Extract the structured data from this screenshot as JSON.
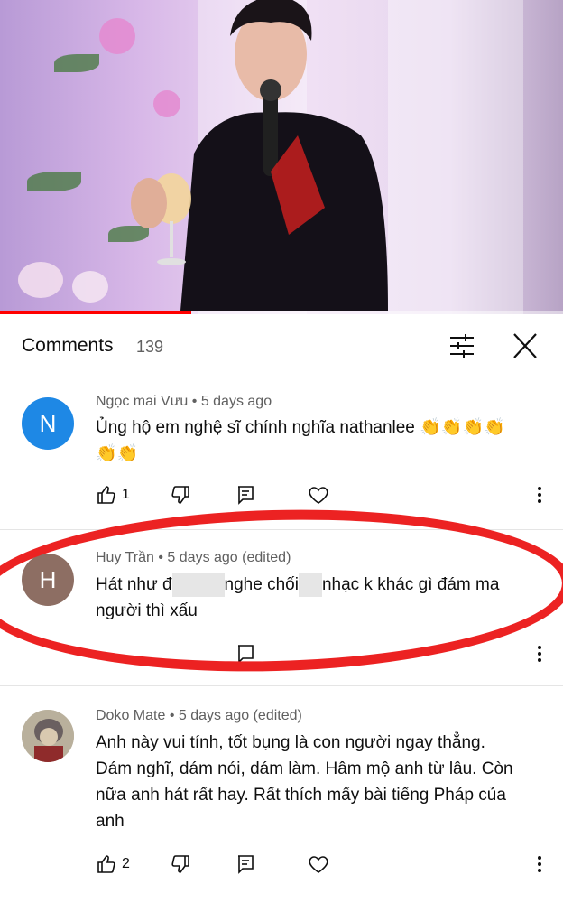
{
  "video": {
    "progress_fraction": 0.34,
    "accent_color": "#ff0000"
  },
  "header": {
    "title": "Comments",
    "count": "139",
    "filter_icon": "filter-sliders-icon",
    "close_icon": "close-icon"
  },
  "comments": [
    {
      "author": "Ngọc mai Vưu",
      "time": "5 days ago",
      "avatar_letter": "N",
      "avatar_color": "#1e88e5",
      "text_line1": "Ủng hộ em nghệ sĩ chính nghĩa nathanlee 👏👏👏👏",
      "text_line2": "👏👏",
      "likes": "1"
    },
    {
      "author": "Huy Trần",
      "time": "5 days ago (edited)",
      "avatar_letter": "H",
      "avatar_color": "#8d6e63",
      "text_part1": "Hát như đ",
      "text_part2": "nghe chối",
      "text_part3": "nhạc k khác gì đám ma",
      "text_line2": "người thì xấu"
    },
    {
      "author": "Doko Mate",
      "time": "5 days ago (edited)",
      "text_line1": "Anh này vui tính, tốt bụng là con người ngay thẳng.",
      "text_line2": "Dám nghĩ, dám nói, dám làm. Hâm mộ anh từ lâu. Còn",
      "text_line3": "nữa anh hát rất hay. Rất thích mấy bài tiếng Pháp của",
      "text_line4": "anh",
      "likes": "2"
    }
  ],
  "colors": {
    "highlight_oval": "#ec2222",
    "meta_text": "#606060"
  }
}
